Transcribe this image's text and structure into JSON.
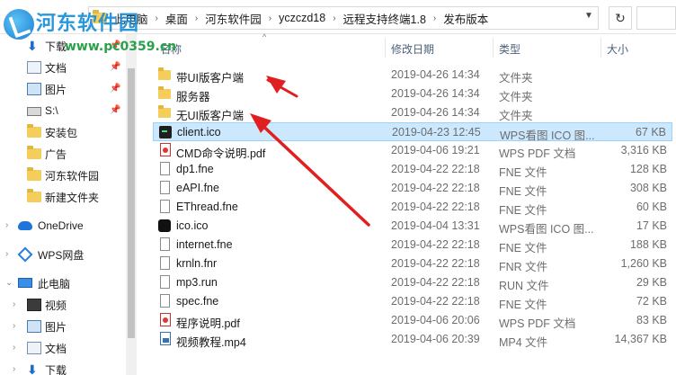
{
  "watermark": {
    "title": "河东软件园",
    "url": "www.pc0359.cn"
  },
  "address": {
    "crumbs": [
      "此电脑",
      "桌面",
      "河东软件园",
      "yczczd18",
      "远程支持终端1.8",
      "发布版本"
    ],
    "refresh_icon": "refresh-icon",
    "dropdown_icon": "chevron-down-icon"
  },
  "nav": {
    "items": [
      {
        "label": "下载",
        "icon": "download-icon",
        "pinned": true
      },
      {
        "label": "文档",
        "icon": "document-icon",
        "pinned": true
      },
      {
        "label": "图片",
        "icon": "picture-icon",
        "pinned": true
      },
      {
        "label": "S:\\",
        "icon": "drive-icon",
        "pinned": true
      },
      {
        "label": "安装包",
        "icon": "folder-icon",
        "pinned": false
      },
      {
        "label": "广告",
        "icon": "folder-icon",
        "pinned": false
      },
      {
        "label": "河东软件园",
        "icon": "folder-icon",
        "pinned": false
      },
      {
        "label": "新建文件夹",
        "icon": "folder-icon",
        "pinned": false
      },
      {
        "label": "OneDrive",
        "icon": "cloud-icon",
        "pinned": false
      },
      {
        "label": "WPS网盘",
        "icon": "wps-icon",
        "pinned": false
      },
      {
        "label": "此电脑",
        "icon": "pc-icon",
        "pinned": false
      },
      {
        "label": "视频",
        "icon": "video-icon",
        "pinned": false
      },
      {
        "label": "图片",
        "icon": "picture-icon",
        "pinned": false
      },
      {
        "label": "文档",
        "icon": "document-icon",
        "pinned": false
      },
      {
        "label": "下载",
        "icon": "download-icon",
        "pinned": false
      }
    ]
  },
  "columns": {
    "name": "名称",
    "date": "修改日期",
    "type": "类型",
    "size": "大小"
  },
  "files": [
    {
      "name": "带UI版客户端",
      "date": "2019-04-26 14:34",
      "type": "文件夹",
      "size": "",
      "icon": "folder-icon"
    },
    {
      "name": "服务器",
      "date": "2019-04-26 14:34",
      "type": "文件夹",
      "size": "",
      "icon": "folder-icon"
    },
    {
      "name": "无UI版客户端",
      "date": "2019-04-26 14:34",
      "type": "文件夹",
      "size": "",
      "icon": "folder-icon"
    },
    {
      "name": "client.ico",
      "date": "2019-04-23 12:45",
      "type": "WPS看图 ICO 图...",
      "size": "67 KB",
      "icon": "terminal-icon",
      "selected": true
    },
    {
      "name": "CMD命令说明.pdf",
      "date": "2019-04-06 19:21",
      "type": "WPS PDF 文档",
      "size": "3,316 KB",
      "icon": "pdf-icon"
    },
    {
      "name": "dp1.fne",
      "date": "2019-04-22 22:18",
      "type": "FNE 文件",
      "size": "128 KB",
      "icon": "file-icon"
    },
    {
      "name": "eAPI.fne",
      "date": "2019-04-22 22:18",
      "type": "FNE 文件",
      "size": "308 KB",
      "icon": "file-icon"
    },
    {
      "name": "EThread.fne",
      "date": "2019-04-22 22:18",
      "type": "FNE 文件",
      "size": "60 KB",
      "icon": "file-icon"
    },
    {
      "name": "ico.ico",
      "date": "2019-04-04 13:31",
      "type": "WPS看图 ICO 图...",
      "size": "17 KB",
      "icon": "image-icon"
    },
    {
      "name": "internet.fne",
      "date": "2019-04-22 22:18",
      "type": "FNE 文件",
      "size": "188 KB",
      "icon": "file-icon"
    },
    {
      "name": "krnln.fnr",
      "date": "2019-04-22 22:18",
      "type": "FNR 文件",
      "size": "1,260 KB",
      "icon": "file-icon"
    },
    {
      "name": "mp3.run",
      "date": "2019-04-22 22:18",
      "type": "RUN 文件",
      "size": "29 KB",
      "icon": "file-icon"
    },
    {
      "name": "spec.fne",
      "date": "2019-04-22 22:18",
      "type": "FNE 文件",
      "size": "72 KB",
      "icon": "file-icon"
    },
    {
      "name": "程序说明.pdf",
      "date": "2019-04-06 20:06",
      "type": "WPS PDF 文档",
      "size": "83 KB",
      "icon": "pdf-icon"
    },
    {
      "name": "视频教程.mp4",
      "date": "2019-04-06 20:39",
      "type": "MP4 文件",
      "size": "14,367 KB",
      "icon": "video-file-icon"
    }
  ],
  "colors": {
    "selection": "#cce8ff",
    "selection_border": "#99d1ff",
    "arrow": "#e02020",
    "folder": "#f5cd5a"
  }
}
